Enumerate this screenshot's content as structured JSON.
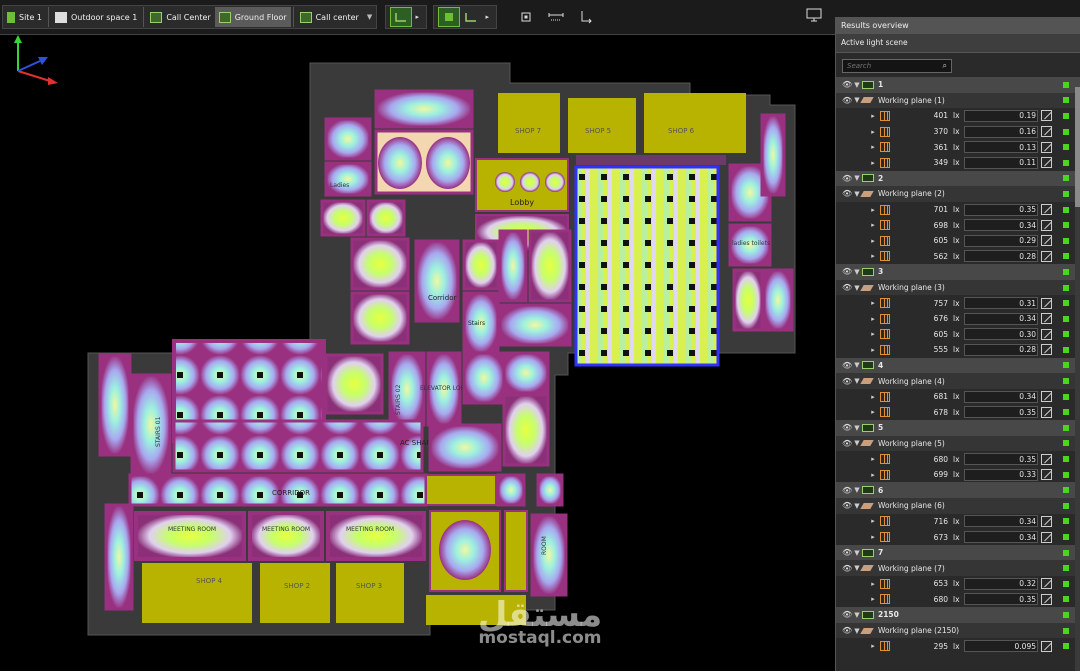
{
  "toolbar": {
    "tabs": [
      {
        "label": "Site 1",
        "icon": "site-icon"
      },
      {
        "label": "Outdoor space 1",
        "icon": "building-icon"
      },
      {
        "label": "Call Center",
        "icon": "building-floors-icon"
      },
      {
        "label": "Ground Floor",
        "icon": "floor-icon"
      },
      {
        "label": "Call center",
        "icon": "room-icon"
      }
    ]
  },
  "panel": {
    "title": "Results overview",
    "subtitle": "Active light scene",
    "search_placeholder": "Search"
  },
  "groups": [
    {
      "id": "1",
      "plane": "Working plane (1)",
      "values": [
        {
          "lx": "401",
          "ratio": "0.19"
        },
        {
          "lx": "370",
          "ratio": "0.16"
        },
        {
          "lx": "361",
          "ratio": "0.13"
        },
        {
          "lx": "349",
          "ratio": "0.11"
        }
      ]
    },
    {
      "id": "2",
      "plane": "Working plane (2)",
      "values": [
        {
          "lx": "701",
          "ratio": "0.35"
        },
        {
          "lx": "698",
          "ratio": "0.34"
        },
        {
          "lx": "605",
          "ratio": "0.29"
        },
        {
          "lx": "562",
          "ratio": "0.28"
        }
      ]
    },
    {
      "id": "3",
      "plane": "Working plane (3)",
      "values": [
        {
          "lx": "757",
          "ratio": "0.31"
        },
        {
          "lx": "676",
          "ratio": "0.34"
        },
        {
          "lx": "605",
          "ratio": "0.30"
        },
        {
          "lx": "555",
          "ratio": "0.28"
        }
      ]
    },
    {
      "id": "4",
      "plane": "Working plane (4)",
      "values": [
        {
          "lx": "681",
          "ratio": "0.34"
        },
        {
          "lx": "678",
          "ratio": "0.35"
        }
      ]
    },
    {
      "id": "5",
      "plane": "Working plane (5)",
      "values": [
        {
          "lx": "680",
          "ratio": "0.35"
        },
        {
          "lx": "699",
          "ratio": "0.33"
        }
      ]
    },
    {
      "id": "6",
      "plane": "Working plane (6)",
      "values": [
        {
          "lx": "716",
          "ratio": "0.34"
        },
        {
          "lx": "673",
          "ratio": "0.34"
        }
      ]
    },
    {
      "id": "7",
      "plane": "Working plane (7)",
      "values": [
        {
          "lx": "653",
          "ratio": "0.32"
        },
        {
          "lx": "680",
          "ratio": "0.35"
        }
      ]
    },
    {
      "id": "2150",
      "plane": "Working plane (2150)",
      "values": [
        {
          "lx": "295",
          "ratio": "0.095"
        }
      ]
    }
  ],
  "unit": "lx",
  "plan_labels": {
    "shop7": "SHOP 7",
    "shop5": "SHOP 5",
    "shop6": "SHOP 6",
    "lobby": "Lobby",
    "corridor_upper": "Corridor",
    "stairs": "Stairs",
    "corridor": "CORRIDOR",
    "shop4": "SHOP 4",
    "shop2": "SHOP 2",
    "shop3": "SHOP 3",
    "stairs01": "STAIRS 01",
    "stairs02": "STAIRS 02",
    "elevator": "ELEVATOR LOBBY",
    "ac_shaft": "AC SHAFT",
    "meeting1": "MEETING ROOM",
    "meeting2": "MEETING ROOM",
    "meeting3": "MEETING ROOM",
    "ladies": "Ladies",
    "room": "ROOM",
    "lift": "LIFT lobby",
    "ladies_wc": "ladies toilets"
  },
  "watermark": {
    "logo": "مستقل",
    "url": "mostaql.com"
  },
  "colors": {
    "status": "#4cd41e",
    "accent": "#6dbf3a",
    "floor_shop": "#b8b300",
    "wall": "#3a3a3a"
  }
}
